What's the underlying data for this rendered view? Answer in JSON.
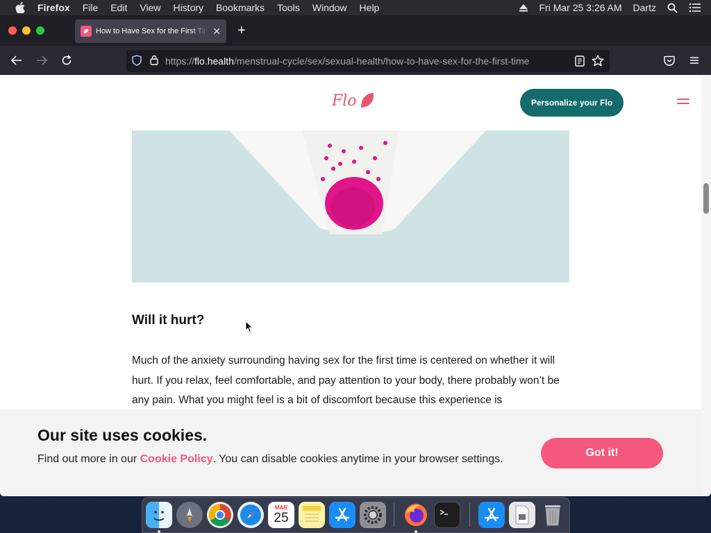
{
  "menubar": {
    "items": [
      "Firefox",
      "File",
      "Edit",
      "View",
      "History",
      "Bookmarks",
      "Tools",
      "Window",
      "Help"
    ],
    "datetime": "Fri Mar 25  3:26 AM",
    "user": "Dartz"
  },
  "browser": {
    "tab_title": "How to Have Sex for the First Time",
    "url_prefix": "https://",
    "url_host": "flo.health",
    "url_path": "/menstrual-cycle/sex/sexual-health/how-to-have-sex-for-the-first-time"
  },
  "site": {
    "logo_text": "Flo",
    "personalize_label": "Personalize your Flo",
    "brand_color": "#f4587c",
    "accent_teal": "#146b6b"
  },
  "article": {
    "heading": "Will it hurt?",
    "paragraph": "Much of the anxiety surrounding having sex for the first time is centered on whether it will hurt. If you relax, feel comfortable, and pay attention to your body, there probably won’t be any pain. What you might feel is a bit of discomfort because this experience is"
  },
  "cookie_banner": {
    "title": "Our site uses cookies.",
    "desc_before": "Find out more in our ",
    "link_text": "Cookie Policy",
    "desc_after": ". You can disable cookies anytime in your browser settings.",
    "button_label": "Got it!"
  },
  "dock": {
    "calendar_month": "MAR",
    "calendar_day": "25",
    "apps": [
      "finder",
      "launchpad",
      "chrome",
      "safari",
      "calendar",
      "notes",
      "app-store",
      "system-preferences",
      "firefox",
      "terminal",
      "app-store-alt",
      "preview",
      "trash"
    ]
  }
}
